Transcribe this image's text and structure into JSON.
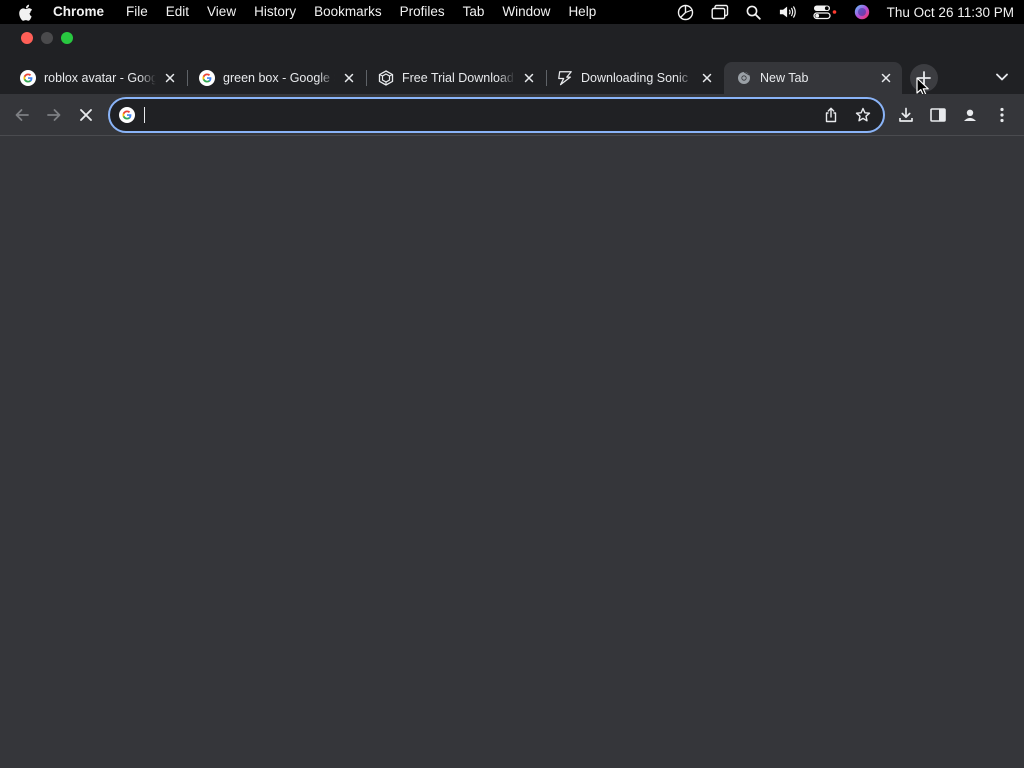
{
  "menubar": {
    "app_name": "Chrome",
    "items": [
      "File",
      "Edit",
      "View",
      "History",
      "Bookmarks",
      "Profiles",
      "Tab",
      "Window",
      "Help"
    ],
    "clock": "Thu Oct 26  11:30 PM"
  },
  "tabs": [
    {
      "title": "roblox avatar - Google Search",
      "favicon": "google-g-icon",
      "active": false
    },
    {
      "title": "green box - Google Search",
      "favicon": "google-g-icon",
      "active": false
    },
    {
      "title": "Free Trial Download",
      "favicon": "cube-logo-icon",
      "active": false
    },
    {
      "title": "Downloading Sonic",
      "favicon": "lightning-logo-icon",
      "active": false
    },
    {
      "title": "New Tab",
      "favicon": "chrome-icon",
      "active": true
    }
  ],
  "omnibox": {
    "value": "",
    "placeholder": ""
  },
  "colors": {
    "accent": "#8ab4f8",
    "window_bg": "#202124",
    "toolbar_bg": "#35363a",
    "close": "#ff5f57",
    "maximize": "#28c840"
  }
}
